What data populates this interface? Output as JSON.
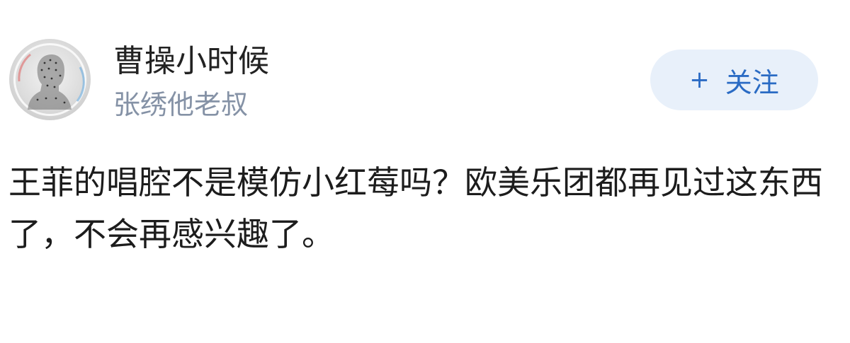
{
  "user": {
    "name": "曹操小时候",
    "subtitle": "张绣他老叔"
  },
  "follow_button": {
    "icon": "+",
    "label": "关注"
  },
  "post": {
    "text": "王菲的唱腔不是模仿小红莓吗？欧美乐团都再见过这东西了，不会再感兴趣了。"
  },
  "colors": {
    "name": "#222222",
    "subtitle": "#8592a6",
    "follow_bg": "#e8f0fa",
    "follow_text": "#2a6bc4"
  }
}
